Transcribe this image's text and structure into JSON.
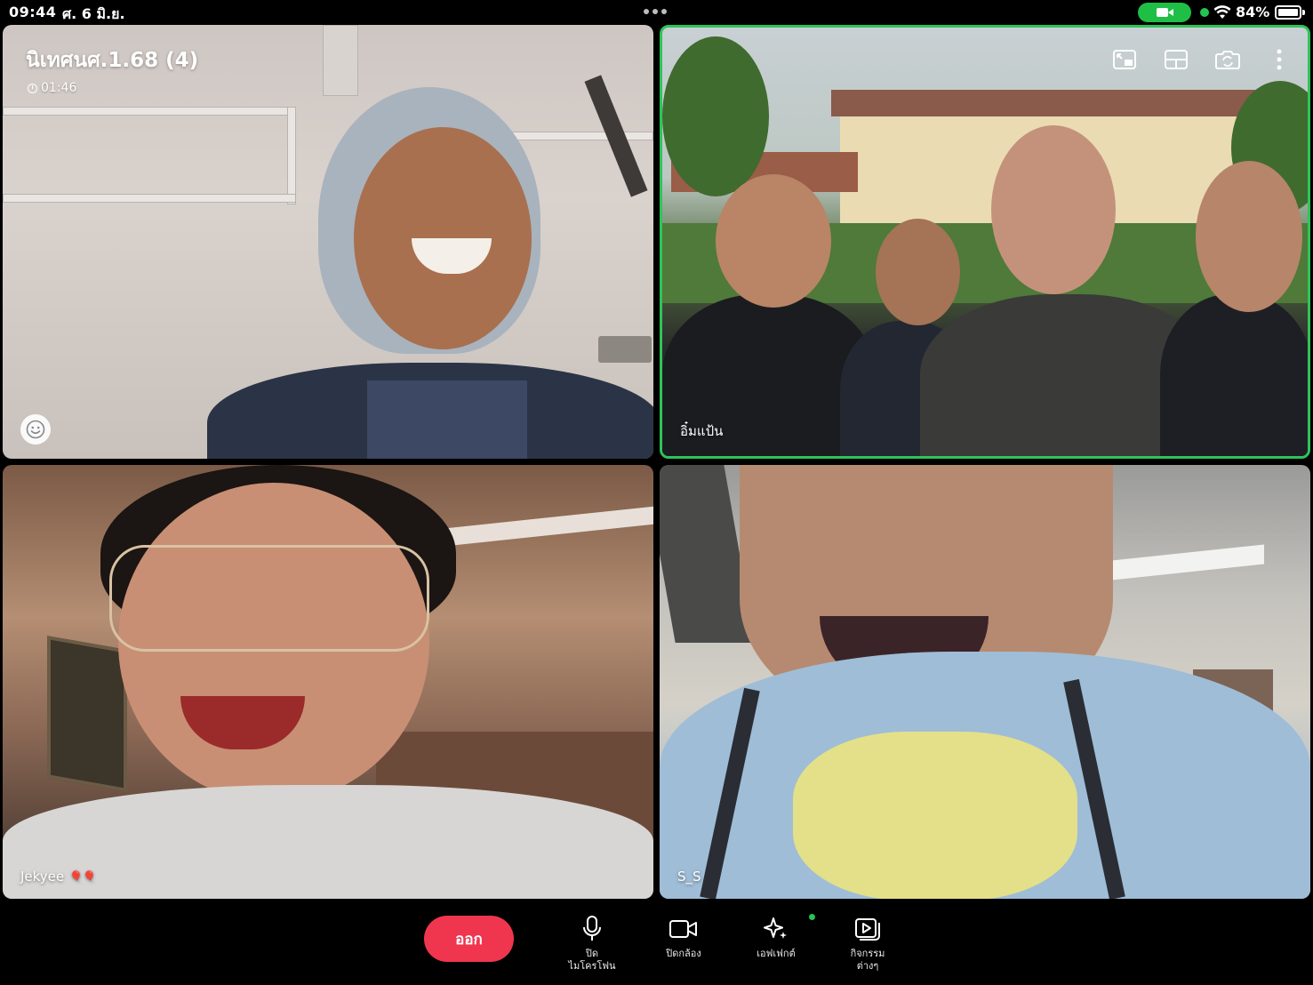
{
  "status_bar": {
    "time": "09:44",
    "date": "ศ. 6 มิ.ย.",
    "battery_percent": "84%",
    "camera_active": true,
    "accent_green": "#1fbf46"
  },
  "call": {
    "title": "นิเทศนศ.1.68 (4)",
    "duration": "01:46"
  },
  "participants": [
    {
      "name": "",
      "has_reaction_button": true
    },
    {
      "name": "อิ๋มแป้น",
      "active_speaker": true
    },
    {
      "name": "Jekyee",
      "emoji": "🎈🎈"
    },
    {
      "name": "S_S"
    }
  ],
  "tile_icons": [
    "picture-in-picture-icon",
    "layout-icon",
    "switch-camera-icon",
    "more-icon"
  ],
  "controls": {
    "leave_label": "ออก",
    "leave_color": "#f0354f",
    "mic_label": "ปิด\nไมโครโฟน",
    "camera_label": "ปิดกล้อง",
    "effects_label": "เอฟเฟกต์",
    "activities_label": "กิจกรรม\nต่างๆ"
  }
}
